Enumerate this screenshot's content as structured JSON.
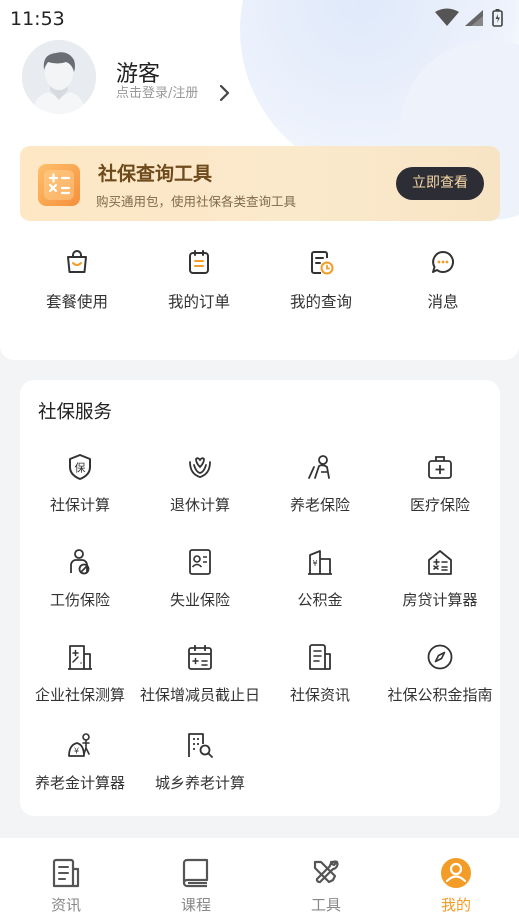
{
  "status_bar": {
    "time": "11:53"
  },
  "profile": {
    "name": "游客",
    "login_hint": "点击登录/注册"
  },
  "banner": {
    "title": "社保查询工具",
    "subtitle": "购买通用包，使用社保各类查询工具",
    "button": "立即查看"
  },
  "quick_actions": [
    {
      "label": "套餐使用",
      "icon": "shopping-bag-icon"
    },
    {
      "label": "我的订单",
      "icon": "order-icon"
    },
    {
      "label": "我的查询",
      "icon": "query-history-icon"
    },
    {
      "label": "消息",
      "icon": "message-icon"
    }
  ],
  "services": {
    "title": "社保服务",
    "items": [
      {
        "label": "社保计算",
        "icon": "shield-bao-icon"
      },
      {
        "label": "退休计算",
        "icon": "flower-hands-icon"
      },
      {
        "label": "养老保险",
        "icon": "elder-icon"
      },
      {
        "label": "医疗保险",
        "icon": "medical-kit-icon"
      },
      {
        "label": "工伤保险",
        "icon": "injury-icon"
      },
      {
        "label": "失业保险",
        "icon": "id-card-icon"
      },
      {
        "label": "公积金",
        "icon": "housing-fund-icon"
      },
      {
        "label": "房贷计算器",
        "icon": "house-calc-icon"
      },
      {
        "label": "企业社保测算",
        "icon": "enterprise-calc-icon"
      },
      {
        "label": "社保增减员截止日",
        "icon": "calendar-icon"
      },
      {
        "label": "社保资讯",
        "icon": "news-icon"
      },
      {
        "label": "社保公积金指南",
        "icon": "compass-icon"
      },
      {
        "label": "养老金计算器",
        "icon": "pension-calc-icon"
      },
      {
        "label": "城乡养老计算",
        "icon": "rural-pension-icon"
      }
    ]
  },
  "tabs": [
    {
      "label": "资讯",
      "icon": "news-tab-icon",
      "active": false
    },
    {
      "label": "课程",
      "icon": "book-tab-icon",
      "active": false
    },
    {
      "label": "工具",
      "icon": "tools-tab-icon",
      "active": false
    },
    {
      "label": "我的",
      "icon": "user-tab-icon",
      "active": true
    }
  ],
  "colors": {
    "accent": "#f39c27",
    "banner_text": "#6e4a1c",
    "button_bg": "#2d2d36"
  }
}
